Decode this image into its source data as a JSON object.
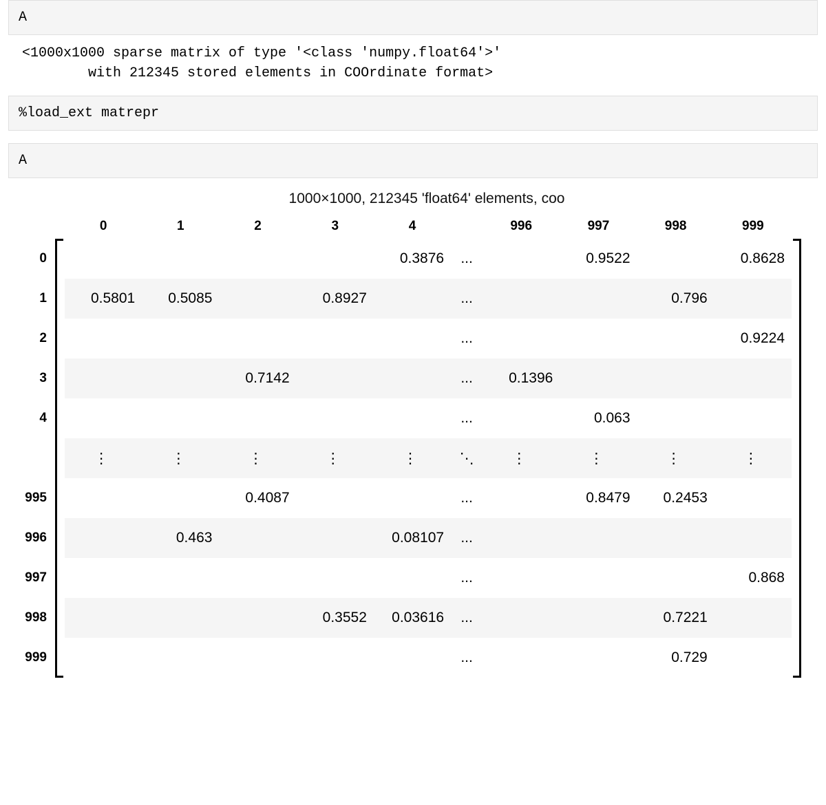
{
  "cells": {
    "cell1_code": "A",
    "cell1_output": "<1000x1000 sparse matrix of type '<class 'numpy.float64'>'\n        with 212345 stored elements in COOrdinate format>",
    "cell2_code": "%load_ext matrepr",
    "cell3_code": "A"
  },
  "matrix": {
    "title": "1000×1000, 212345 'float64' elements, coo",
    "col_headers": [
      "0",
      "1",
      "2",
      "3",
      "4",
      "",
      "996",
      "997",
      "998",
      "999"
    ],
    "row_headers": [
      "0",
      "1",
      "2",
      "3",
      "4",
      "",
      "995",
      "996",
      "997",
      "998",
      "999"
    ],
    "hdots": "...",
    "vdots": "⋮",
    "ddots": "⋱",
    "rows": [
      {
        "zebra": false,
        "cells": [
          "",
          "",
          "",
          "",
          "0.3876",
          "...",
          "",
          "0.9522",
          "",
          "0.8628"
        ]
      },
      {
        "zebra": true,
        "cells": [
          "0.5801",
          "0.5085",
          "",
          "0.8927",
          "",
          "...",
          "",
          "",
          "0.796",
          ""
        ]
      },
      {
        "zebra": false,
        "cells": [
          "",
          "",
          "",
          "",
          "",
          "...",
          "",
          "",
          "",
          "0.9224"
        ]
      },
      {
        "zebra": true,
        "cells": [
          "",
          "",
          "0.7142",
          "",
          "",
          "...",
          "0.1396",
          "",
          "",
          ""
        ]
      },
      {
        "zebra": false,
        "cells": [
          "",
          "",
          "",
          "",
          "",
          "...",
          "",
          "0.063",
          "",
          ""
        ]
      },
      {
        "zebra": true,
        "cells": [
          "⋮",
          "⋮",
          "⋮",
          "⋮",
          "⋮",
          "⋱",
          "⋮",
          "⋮",
          "⋮",
          "⋮"
        ],
        "vdots_row": true
      },
      {
        "zebra": false,
        "cells": [
          "",
          "",
          "0.4087",
          "",
          "",
          "...",
          "",
          "0.8479",
          "0.2453",
          ""
        ]
      },
      {
        "zebra": true,
        "cells": [
          "",
          "0.463",
          "",
          "",
          "0.08107",
          "...",
          "",
          "",
          "",
          ""
        ]
      },
      {
        "zebra": false,
        "cells": [
          "",
          "",
          "",
          "",
          "",
          "...",
          "",
          "",
          "",
          "0.868"
        ]
      },
      {
        "zebra": true,
        "cells": [
          "",
          "",
          "",
          "0.3552",
          "0.03616",
          "...",
          "",
          "",
          "0.7221",
          ""
        ]
      },
      {
        "zebra": false,
        "cells": [
          "",
          "",
          "",
          "",
          "",
          "...",
          "",
          "",
          "0.729",
          ""
        ]
      }
    ]
  },
  "chart_data": {
    "type": "table",
    "title": "1000×1000, 212345 'float64' elements, coo",
    "shape": [
      1000,
      1000
    ],
    "nnz": 212345,
    "dtype": "float64",
    "format": "coo",
    "displayed_columns": [
      0,
      1,
      2,
      3,
      4,
      996,
      997,
      998,
      999
    ],
    "displayed_rows": [
      0,
      1,
      2,
      3,
      4,
      995,
      996,
      997,
      998,
      999
    ],
    "visible_entries": [
      {
        "row": 0,
        "col": 4,
        "value": 0.3876
      },
      {
        "row": 0,
        "col": 997,
        "value": 0.9522
      },
      {
        "row": 0,
        "col": 999,
        "value": 0.8628
      },
      {
        "row": 1,
        "col": 0,
        "value": 0.5801
      },
      {
        "row": 1,
        "col": 1,
        "value": 0.5085
      },
      {
        "row": 1,
        "col": 3,
        "value": 0.8927
      },
      {
        "row": 1,
        "col": 998,
        "value": 0.796
      },
      {
        "row": 2,
        "col": 999,
        "value": 0.9224
      },
      {
        "row": 3,
        "col": 2,
        "value": 0.7142
      },
      {
        "row": 3,
        "col": 996,
        "value": 0.1396
      },
      {
        "row": 4,
        "col": 997,
        "value": 0.063
      },
      {
        "row": 995,
        "col": 2,
        "value": 0.4087
      },
      {
        "row": 995,
        "col": 997,
        "value": 0.8479
      },
      {
        "row": 995,
        "col": 998,
        "value": 0.2453
      },
      {
        "row": 996,
        "col": 1,
        "value": 0.463
      },
      {
        "row": 996,
        "col": 4,
        "value": 0.08107
      },
      {
        "row": 997,
        "col": 999,
        "value": 0.868
      },
      {
        "row": 998,
        "col": 3,
        "value": 0.3552
      },
      {
        "row": 998,
        "col": 4,
        "value": 0.03616
      },
      {
        "row": 998,
        "col": 998,
        "value": 0.7221
      },
      {
        "row": 999,
        "col": 998,
        "value": 0.729
      }
    ]
  }
}
